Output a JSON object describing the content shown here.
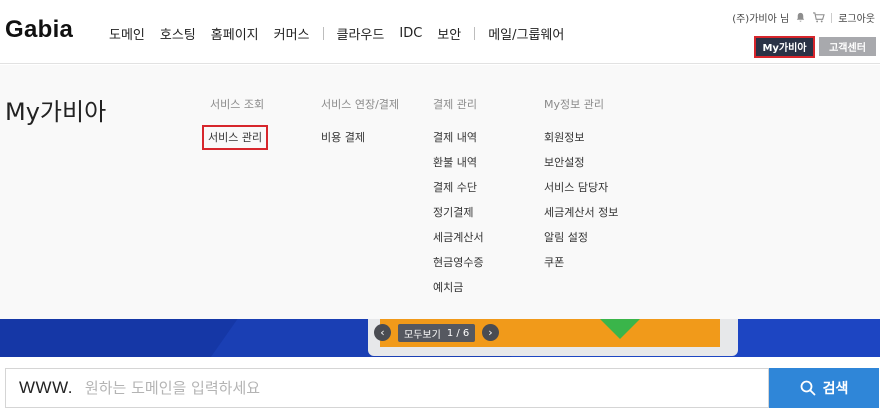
{
  "header": {
    "logo": "Gabia",
    "nav": [
      "도메인",
      "호스팅",
      "홈페이지",
      "커머스",
      "|",
      "클라우드",
      "IDC",
      "보안",
      "|",
      "메일/그룹웨어"
    ],
    "user_name": "(주)가비아 님",
    "logout_label": "로그아웃",
    "my_gabia_button": "My가비아",
    "customer_center_button": "고객센터"
  },
  "menu": {
    "title": "My가비아",
    "columns": [
      {
        "title": "서비스 조회",
        "links": [
          "서비스 관리"
        ]
      },
      {
        "title": "서비스 연장/결제",
        "links": [
          "비용 결제"
        ]
      },
      {
        "title": "결제 관리",
        "links": [
          "결제 내역",
          "환불 내역",
          "결제 수단",
          "정기결제",
          "세금계산서",
          "현금영수증",
          "예치금"
        ]
      },
      {
        "title": "My정보 관리",
        "links": [
          "회원정보",
          "보안설정",
          "서비스 담당자",
          "세금계산서 정보",
          "알림 설정",
          "쿠폰"
        ]
      }
    ],
    "highlighted_link": "서비스 관리"
  },
  "banner": {
    "view_all_label": "모두보기",
    "page_indicator": "1 / 6"
  },
  "search": {
    "prefix": "WWW.",
    "placeholder": "원하는 도메인을 입력하세요",
    "button_label": "검색"
  },
  "colors": {
    "my_gabia_bg": "#2a3246",
    "highlight_border": "#d7262c",
    "search_button": "#2f86d8",
    "banner_blue": "#1a3fb4"
  }
}
